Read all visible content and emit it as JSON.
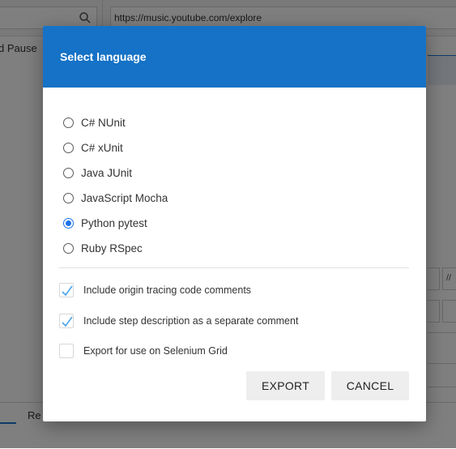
{
  "background": {
    "url": "https://music.youtube.com/explore",
    "left_panel_label": "d Pause",
    "bottom_tab_label": "Re",
    "right_button_label": "//"
  },
  "dialog": {
    "title": "Select language",
    "languages": [
      {
        "label": "C# NUnit",
        "selected": false
      },
      {
        "label": "C# xUnit",
        "selected": false
      },
      {
        "label": "Java JUnit",
        "selected": false
      },
      {
        "label": "JavaScript Mocha",
        "selected": false
      },
      {
        "label": "Python pytest",
        "selected": true
      },
      {
        "label": "Ruby RSpec",
        "selected": false
      }
    ],
    "options": [
      {
        "label": "Include origin tracing code comments",
        "checked": true
      },
      {
        "label": "Include step description as a separate comment",
        "checked": true
      },
      {
        "label": "Export for use on Selenium Grid",
        "checked": false
      }
    ],
    "export_label": "EXPORT",
    "cancel_label": "CANCEL"
  },
  "colors": {
    "header": "#1572c6",
    "accent": "#1a73e8",
    "checkmark": "#4aa3ea"
  }
}
